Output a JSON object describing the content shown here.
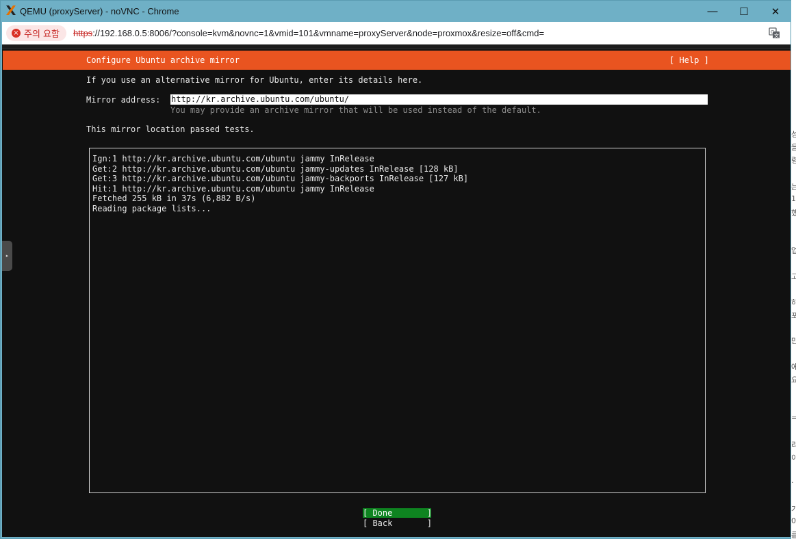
{
  "window": {
    "title": "QEMU (proxyServer) - noVNC - Chrome",
    "minimize_glyph": "—",
    "maximize_glyph": "☐",
    "close_glyph": "✕"
  },
  "addressbar": {
    "security_label": "주의 요함",
    "url_scheme": "https",
    "url_rest": "://192.168.0.5:8006/?console=kvm&novnc=1&vmid=101&vmname=proxyServer&node=proxmox&resize=off&cmd="
  },
  "installer": {
    "header_title": "Configure Ubuntu archive mirror",
    "help_label": "[ Help ]",
    "intro": "If you use an alternative mirror for Ubuntu, enter its details here.",
    "mirror_label": "Mirror address:",
    "mirror_value": "http://kr.archive.ubuntu.com/ubuntu/",
    "mirror_hint": "You may provide an archive mirror that will be used instead of the default.",
    "status": "This mirror location passed tests.",
    "log": [
      "Ign:1 http://kr.archive.ubuntu.com/ubuntu jammy InRelease",
      "Get:2 http://kr.archive.ubuntu.com/ubuntu jammy-updates InRelease [128 kB]",
      "Get:3 http://kr.archive.ubuntu.com/ubuntu jammy-backports InRelease [127 kB]",
      "Hit:1 http://kr.archive.ubuntu.com/ubuntu jammy InRelease",
      "Fetched 255 kB in 37s (6,882 B/s)",
      "Reading package lists..."
    ],
    "done_label": "[ Done       ]",
    "back_label": "[ Back       ]"
  },
  "novnc": {
    "control_handle_glyph": "▸"
  },
  "background_page": {
    "edge_chars": [
      "성",
      "을",
      "령",
      "는",
      "1",
      "했",
      "업",
      "고",
      "하",
      "포",
      "만",
      "에",
      "요",
      "=",
      "리",
      "이",
      "·",
      "가",
      "0",
      "릅"
    ]
  },
  "colors": {
    "titlebar": "#6fb0c6",
    "ubuntu_orange": "#e95420",
    "done_green": "#0e8420",
    "terminal_bg": "#111111"
  }
}
